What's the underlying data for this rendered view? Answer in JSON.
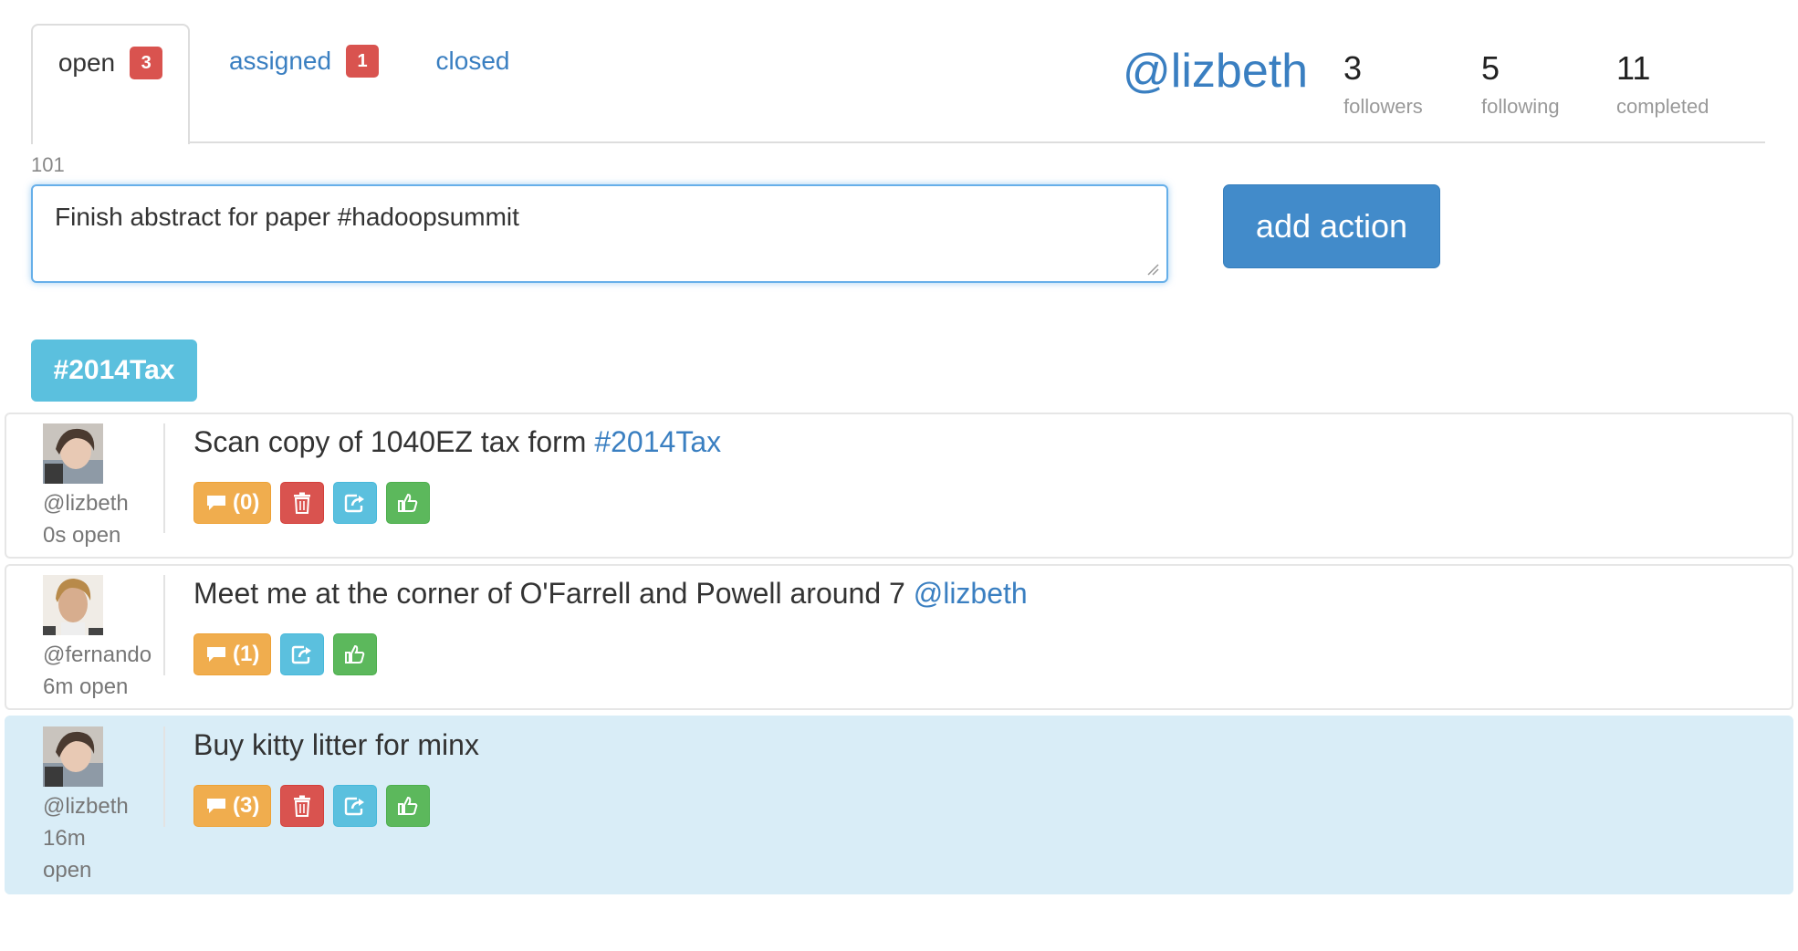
{
  "tabs": [
    {
      "label": "open",
      "count": "3"
    },
    {
      "label": "assigned",
      "count": "1"
    },
    {
      "label": "closed",
      "count": ""
    }
  ],
  "profile": {
    "handle": "@lizbeth",
    "stats": [
      {
        "value": "3",
        "label": "followers"
      },
      {
        "value": "5",
        "label": "following"
      },
      {
        "value": "11",
        "label": "completed"
      }
    ]
  },
  "composer": {
    "char_count": "101",
    "text": "Finish abstract for paper #hadoopsummit",
    "submit_label": "add action"
  },
  "filter_tag": "#2014Tax",
  "items": [
    {
      "text": "Scan copy of 1040EZ tax form ",
      "link": "#2014Tax",
      "user": "@lizbeth",
      "age": "0s open",
      "comments": "(0)"
    },
    {
      "text": "Meet me at the corner of O'Farrell and Powell around 7 ",
      "link": "@lizbeth",
      "user": "@fernando",
      "age": "6m open",
      "comments": "(1)"
    },
    {
      "text": "Buy kitty litter for minx",
      "link": "",
      "user": "@lizbeth",
      "age": "16m",
      "age2": "open",
      "comments": "(3)"
    }
  ],
  "colors": {
    "primary": "#428bca",
    "info": "#5bc0de",
    "warning": "#f0ad4e",
    "danger": "#d9534f",
    "success": "#5cb85c",
    "highlight_row": "#d9edf7",
    "link": "#3a7fc1"
  },
  "icons": {
    "comment": "comment-icon",
    "delete": "trash-icon",
    "share": "share-icon",
    "like": "thumbs-up-icon"
  }
}
